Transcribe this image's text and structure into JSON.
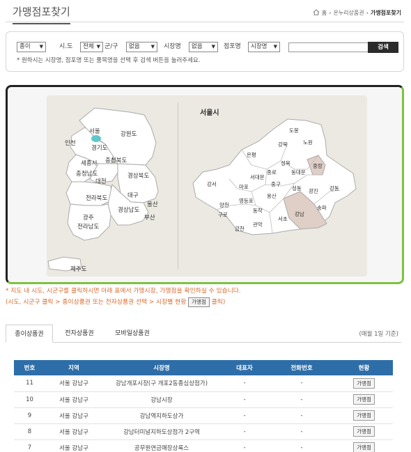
{
  "header": {
    "title": "가맹점포찾기",
    "breadcrumb": [
      "홈",
      "온누리상품권",
      "가맹점포찾기"
    ]
  },
  "search": {
    "type_value": "종이",
    "sido_label": "시.도",
    "sido_value": "전체",
    "gungu_label": "군/구",
    "gungu_value": "없음",
    "market_label": "시장명",
    "market_value": "없음",
    "store_label": "점포명",
    "store_value": "시장명",
    "button": "검색",
    "note": "* 원하시는 시장명, 점포명 또는 품목명을 선택 후 검색 버튼을 눌러주세요."
  },
  "map": {
    "korea_regions": [
      "서울",
      "인천",
      "경기도",
      "강원도",
      "세종시",
      "충청북도",
      "충청남도",
      "대전",
      "경상북도",
      "대구",
      "전라북도",
      "울산",
      "경상남도",
      "광주",
      "부산",
      "전라남도",
      "제주도"
    ],
    "seoul_title": "서울시",
    "seoul_districts": [
      "도봉",
      "강북",
      "노원",
      "은평",
      "성북",
      "중랑",
      "종로",
      "동대문",
      "서대문",
      "마포",
      "중구",
      "강서",
      "성동",
      "광진",
      "강동",
      "용산",
      "양천",
      "영등포",
      "동작",
      "구로",
      "강남",
      "송파",
      "서초",
      "금천",
      "관악"
    ],
    "highlight_color": "#e0cfc6",
    "seoul_dot_color": "#5fc7c9"
  },
  "info": {
    "line1": "* 지도 내 시도, 시군구를 클릭하시면 아래 표에서 가맹시장, 가맹점을 확인하실 수 있습니다.",
    "line2_pre": "(시도,  시군구 클릭 > 종이상품권 또는 전자상품권 선택 > 시장별 현황",
    "line2_btn": "가맹점",
    "line2_post": "클릭)"
  },
  "tabs": {
    "items": [
      "종이상품권",
      "전자상품권",
      "모바일상품권"
    ],
    "date_note": "(매월 1일 기준)"
  },
  "table": {
    "headers": [
      "번호",
      "지역",
      "시장명",
      "대표자",
      "전화번호",
      "현황"
    ],
    "rows": [
      {
        "no": "11",
        "region": "서울 강남구",
        "market": "강남개포시장(구 개포2동종심상점가)",
        "rep": "-",
        "phone": "-",
        "btn": "가맹점"
      },
      {
        "no": "10",
        "region": "서울 강남구",
        "market": "강남시장",
        "rep": "-",
        "phone": "-",
        "btn": "가맹점"
      },
      {
        "no": "9",
        "region": "서울 강남구",
        "market": "강남역지하도상가",
        "rep": "-",
        "phone": "-",
        "btn": "가맹점"
      },
      {
        "no": "8",
        "region": "서울 강남구",
        "market": "강남터미널지하도상점가 2구역",
        "rep": "-",
        "phone": "-",
        "btn": "가맹점"
      },
      {
        "no": "7",
        "region": "서울 강남구",
        "market": "공무원연금매장상록스",
        "rep": "-",
        "phone": "-",
        "btn": "가맹점"
      }
    ]
  }
}
